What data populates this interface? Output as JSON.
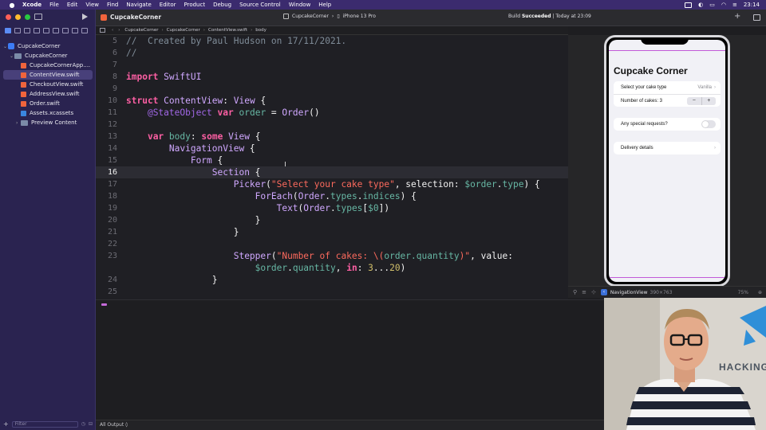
{
  "menubar": {
    "app_name": "Xcode",
    "items": [
      "File",
      "Edit",
      "View",
      "Find",
      "Navigate",
      "Editor",
      "Product",
      "Debug",
      "Source Control",
      "Window",
      "Help"
    ],
    "clock": "23:14"
  },
  "toolbar": {
    "tab_title": "CupcakeCorner",
    "scheme_project": "CupcakeCorner",
    "scheme_device": "iPhone 13 Pro",
    "build_prefix": "Build",
    "build_result": "Succeeded",
    "build_time": "Today at 23:09"
  },
  "navigator": {
    "items": [
      {
        "label": "CupcakeCorner",
        "kind": "project-icon",
        "indent": 0,
        "expanded": true
      },
      {
        "label": "CupcakeCorner",
        "kind": "folder-icon",
        "indent": 1,
        "expanded": true
      },
      {
        "label": "CupcakeCornerApp....",
        "kind": "swift-file-icon",
        "indent": 2
      },
      {
        "label": "ContentView.swift",
        "kind": "swift-file-icon",
        "indent": 2,
        "selected": true
      },
      {
        "label": "CheckoutView.swift",
        "kind": "swift-file-icon",
        "indent": 2
      },
      {
        "label": "AddressView.swift",
        "kind": "swift-file-icon",
        "indent": 2
      },
      {
        "label": "Order.swift",
        "kind": "swift-file-icon",
        "indent": 2
      },
      {
        "label": "Assets.xcassets",
        "kind": "assets-icon",
        "indent": 2
      },
      {
        "label": "Preview Content",
        "kind": "folder-icon",
        "indent": 2,
        "expanded": false
      }
    ],
    "filter_placeholder": "Filter"
  },
  "jumpbar": {
    "crumbs": [
      "CupcakeCorner",
      "CupcakeCorner",
      "ContentView.swift",
      "body"
    ]
  },
  "editor": {
    "current_line": 16,
    "lines": [
      {
        "n": "5",
        "c": "//  Created by Paul Hudson on 17/11/2021."
      },
      {
        "n": "6",
        "c": "//"
      },
      {
        "n": "7",
        "c": ""
      },
      {
        "n": "8",
        "c": "import SwiftUI"
      },
      {
        "n": "9",
        "c": ""
      },
      {
        "n": "10",
        "c": "struct ContentView: View {"
      },
      {
        "n": "11",
        "c": "    @StateObject var order = Order()"
      },
      {
        "n": "12",
        "c": ""
      },
      {
        "n": "13",
        "c": "    var body: some View {"
      },
      {
        "n": "14",
        "c": "        NavigationView {"
      },
      {
        "n": "15",
        "c": "            Form {"
      },
      {
        "n": "16",
        "c": "                Section {"
      },
      {
        "n": "17",
        "c": "                    Picker(\"Select your cake type\", selection: $order.type) {"
      },
      {
        "n": "18",
        "c": "                        ForEach(Order.types.indices) {"
      },
      {
        "n": "19",
        "c": "                            Text(Order.types[$0])"
      },
      {
        "n": "20",
        "c": "                        }"
      },
      {
        "n": "21",
        "c": "                    }"
      },
      {
        "n": "22",
        "c": ""
      },
      {
        "n": "23",
        "c": "                    Stepper(\"Number of cakes: \\(order.quantity)\", value:"
      },
      {
        "n": "",
        "c": "                        $order.quantity, in: 3...20)"
      },
      {
        "n": "24",
        "c": "                }"
      },
      {
        "n": "25",
        "c": ""
      }
    ]
  },
  "preview": {
    "title": "Cupcake Corner",
    "cake_type_label": "Select your cake type",
    "cake_type_value": "Vanilla",
    "quantity_label": "Number of cakes: 3",
    "stepper_minus": "−",
    "stepper_plus": "+",
    "special_label": "Any special requests?",
    "special_on": false,
    "delivery_label": "Delivery details",
    "selected_view": "NavigationView",
    "selected_size": "390×763",
    "zoom": "75%"
  },
  "debug": {
    "output_selector": "All Output ◊"
  },
  "webcam": {
    "watermark": "HACKING"
  },
  "colors": {
    "accent": "#5b8cf5",
    "sidebar": "#2a2350",
    "keyword": "#fc5fa3",
    "type": "#d0a8ff",
    "string": "#fc6a5d",
    "comment": "#7f8c98"
  }
}
